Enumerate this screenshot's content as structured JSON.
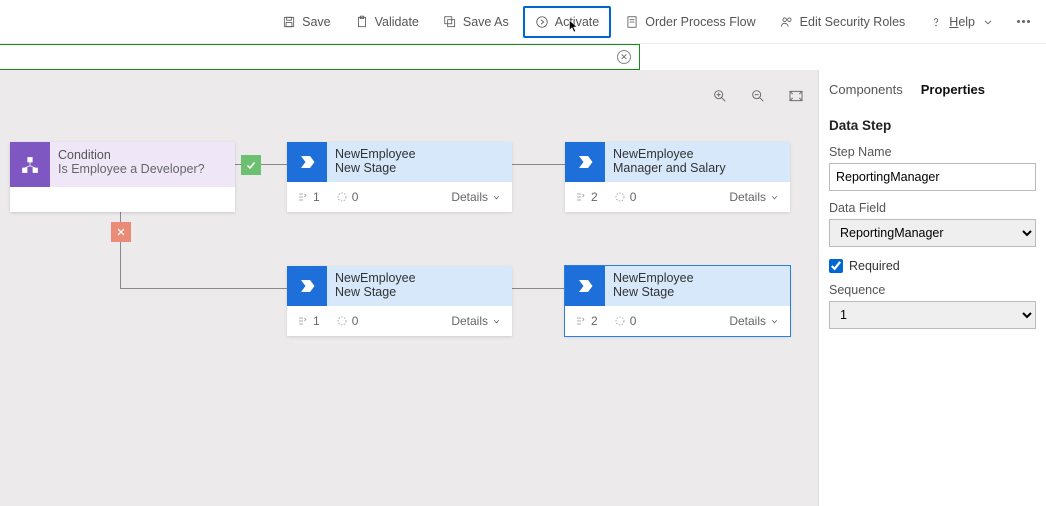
{
  "toolbar": {
    "save": "Save",
    "validate": "Validate",
    "save_as": "Save As",
    "activate": "Activate",
    "order": "Order Process Flow",
    "security": "Edit Security Roles",
    "help": "Help"
  },
  "canvas": {
    "condition": {
      "title": "Condition",
      "subtitle": "Is Employee a Developer?"
    },
    "stages": [
      {
        "title": "NewEmployee",
        "subtitle": "New Stage",
        "steps": "1",
        "branches": "0",
        "details": "Details"
      },
      {
        "title": "NewEmployee",
        "subtitle": "Manager and Salary",
        "steps": "2",
        "branches": "0",
        "details": "Details"
      },
      {
        "title": "NewEmployee",
        "subtitle": "New Stage",
        "steps": "1",
        "branches": "0",
        "details": "Details"
      },
      {
        "title": "NewEmployee",
        "subtitle": "New Stage",
        "steps": "2",
        "branches": "0",
        "details": "Details"
      }
    ]
  },
  "side": {
    "tabs": {
      "components": "Components",
      "properties": "Properties"
    },
    "section": "Data Step",
    "step_name_label": "Step Name",
    "step_name_value": "ReportingManager",
    "data_field_label": "Data Field",
    "data_field_value": "ReportingManager",
    "required_label": "Required",
    "sequence_label": "Sequence",
    "sequence_value": "1"
  }
}
